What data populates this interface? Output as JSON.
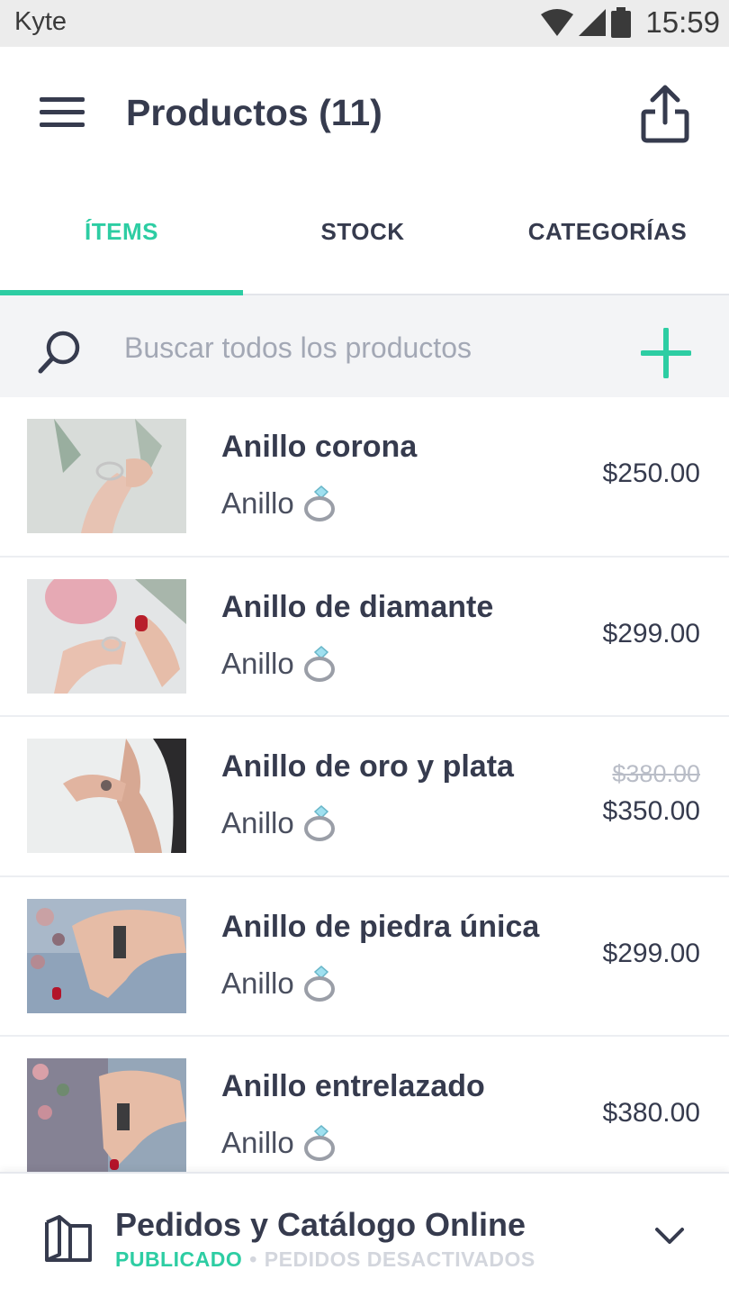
{
  "status_bar": {
    "app_name": "Kyte",
    "time": "15:59"
  },
  "header": {
    "title": "Productos (11)",
    "menu_icon": "hamburger-menu-icon",
    "share_icon": "share-upload-icon"
  },
  "tabs": [
    {
      "label": "ÍTEMS",
      "active": true
    },
    {
      "label": "STOCK",
      "active": false
    },
    {
      "label": "CATEGORÍAS",
      "active": false
    }
  ],
  "search": {
    "placeholder": "Buscar todos los productos",
    "value": "",
    "icon": "search-icon",
    "add_icon": "plus-icon"
  },
  "products": [
    {
      "name": "Anillo corona",
      "category": "Anillo",
      "price": "$250.00",
      "old_price": ""
    },
    {
      "name": "Anillo de diamante",
      "category": "Anillo",
      "price": "$299.00",
      "old_price": ""
    },
    {
      "name": "Anillo de oro y plata",
      "category": "Anillo",
      "price": "$350.00",
      "old_price": "$380.00"
    },
    {
      "name": "Anillo de piedra única",
      "category": "Anillo",
      "price": "$299.00",
      "old_price": ""
    },
    {
      "name": "Anillo entrelazado",
      "category": "Anillo",
      "price": "$380.00",
      "old_price": ""
    }
  ],
  "catalog": {
    "title": "Pedidos y Catálogo Online",
    "status_published": "PUBLICADO",
    "separator": "•",
    "status_orders": "PEDIDOS DESACTIVADOS"
  },
  "colors": {
    "accent": "#2dcda3",
    "text": "#363b4e",
    "muted": "#a3a8b5"
  }
}
